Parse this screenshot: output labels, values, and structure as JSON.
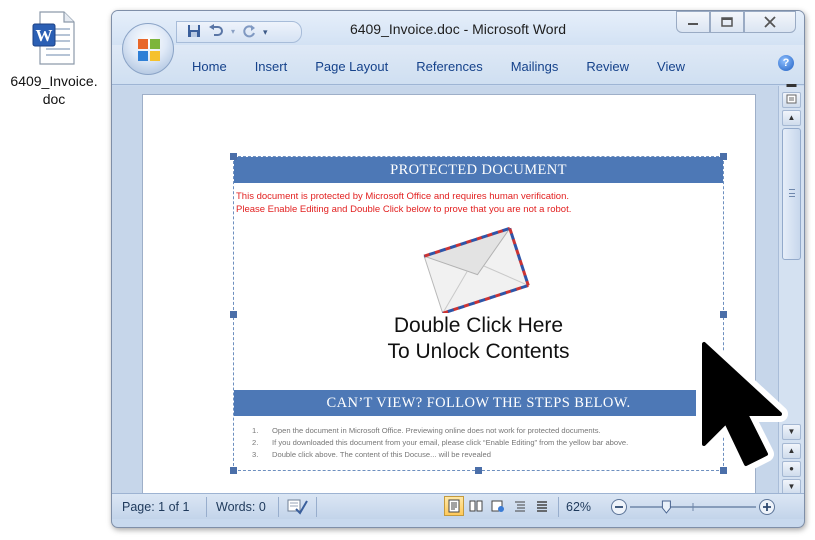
{
  "desktop": {
    "file_label_line1": "6409_Invoice.",
    "file_label_line2": "doc",
    "icon": "word-document-icon"
  },
  "window": {
    "title": "6409_Invoice.doc - Microsoft Word",
    "quick_access": {
      "save_icon": "save-icon",
      "undo_icon": "undo-icon",
      "redo_icon": "redo-icon",
      "customize_icon": "qat-dropdown-icon"
    },
    "controls": [
      "minimize",
      "maximize",
      "close"
    ]
  },
  "ribbon": {
    "tabs": [
      "Home",
      "Insert",
      "Page Layout",
      "References",
      "Mailings",
      "Review",
      "View"
    ],
    "help": "?"
  },
  "document": {
    "banner_top": "PROTECTED DOCUMENT",
    "warning_line1": "This document is protected by Microsoft Office and requires human verification.",
    "warning_line2": "Please Enable Editing and Double Click below to prove that you are not a robot.",
    "unlock_line1": "Double Click Here",
    "unlock_line2": "To Unlock Contents",
    "banner_bottom": "CAN’T VIEW? FOLLOW THE STEPS BELOW.",
    "steps": [
      {
        "num": "1.",
        "text": "Open the document in Microsoft Office. Previewing online does not work for protected documents."
      },
      {
        "num": "2.",
        "text": "If you downloaded this document from your email, please click “Enable Editing” from the yellow bar above."
      },
      {
        "num": "3.",
        "text": "Double click above. The content of this Docuse... will be revealed"
      }
    ]
  },
  "status_bar": {
    "page": "Page: 1 of 1",
    "words": "Words: 0",
    "zoom": "62%",
    "zoom_level_fraction": 0.62
  },
  "colors": {
    "banner": "#4d78b6",
    "warning_text": "#e21f1f",
    "ribbon_text": "#15428b",
    "active_view": "#ffc95a"
  }
}
